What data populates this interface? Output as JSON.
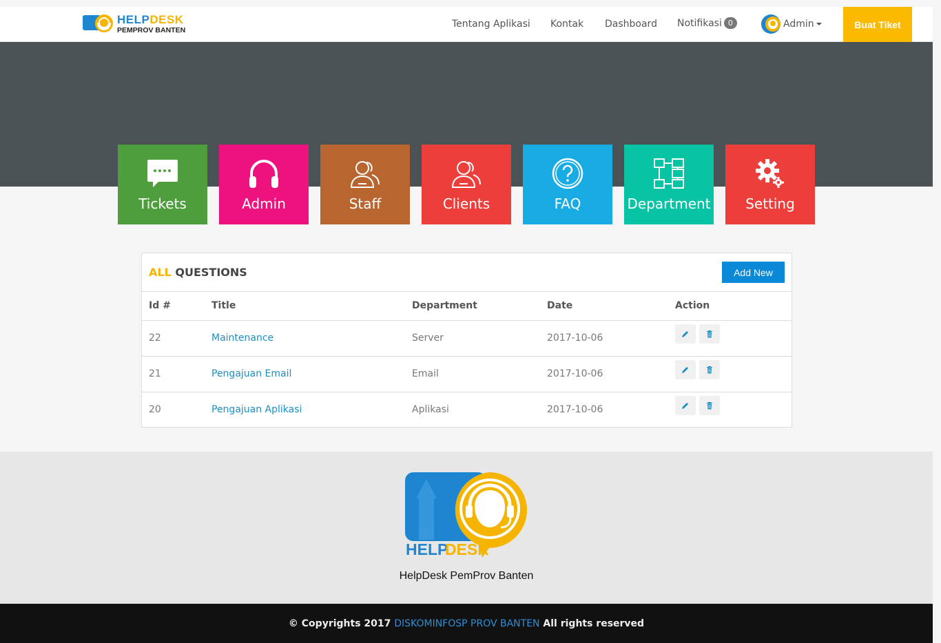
{
  "brand": {
    "line1_a": "HELP",
    "line1_b": "DESK",
    "line2": "PEMPROV BANTEN"
  },
  "nav": {
    "about": "Tentang Aplikasi",
    "contact": "Kontak",
    "dashboard": "Dashboard",
    "notifications": "Notifikasi",
    "notification_count": "0",
    "user": "Admin",
    "create_ticket": "Buat Tiket"
  },
  "tiles": [
    {
      "label": "Tickets",
      "color": "#4e9e3d",
      "icon": "chat-icon"
    },
    {
      "label": "Admin",
      "color": "#ee127f",
      "icon": "headphones-icon"
    },
    {
      "label": "Staff",
      "color": "#b96530",
      "icon": "users-icon"
    },
    {
      "label": "Clients",
      "color": "#ec3e3a",
      "icon": "users-icon"
    },
    {
      "label": "FAQ",
      "color": "#19ace4",
      "icon": "question-icon"
    },
    {
      "label": "Department",
      "color": "#09c3a5",
      "icon": "sitemap-icon"
    },
    {
      "label": "Setting",
      "color": "#ec3e3a",
      "icon": "gear-icon"
    }
  ],
  "panel": {
    "title_accent": "ALL",
    "title_rest": "QUESTIONS",
    "add_label": "Add New",
    "columns": [
      "Id #",
      "Title",
      "Department",
      "Date",
      "Action"
    ],
    "rows": [
      {
        "id": "22",
        "title": "Maintenance",
        "department": "Server",
        "date": "2017-10-06"
      },
      {
        "id": "21",
        "title": "Pengajuan Email",
        "department": "Email",
        "date": "2017-10-06"
      },
      {
        "id": "20",
        "title": "Pengajuan Aplikasi",
        "department": "Aplikasi",
        "date": "2017-10-06"
      }
    ]
  },
  "footer": {
    "logo_text_a": "HELP",
    "logo_text_b": "DESK",
    "name": "HelpDesk PemProv Banten",
    "copyright_a": "© Copyrights 2017",
    "copyright_org": "DISKOMINFOSP PROV BANTEN",
    "copyright_b": "All rights reserved"
  },
  "colors": {
    "accent": "#fbb900",
    "link": "#1a8fc4",
    "hero": "#4a5255",
    "add_button": "#0a89d8"
  }
}
